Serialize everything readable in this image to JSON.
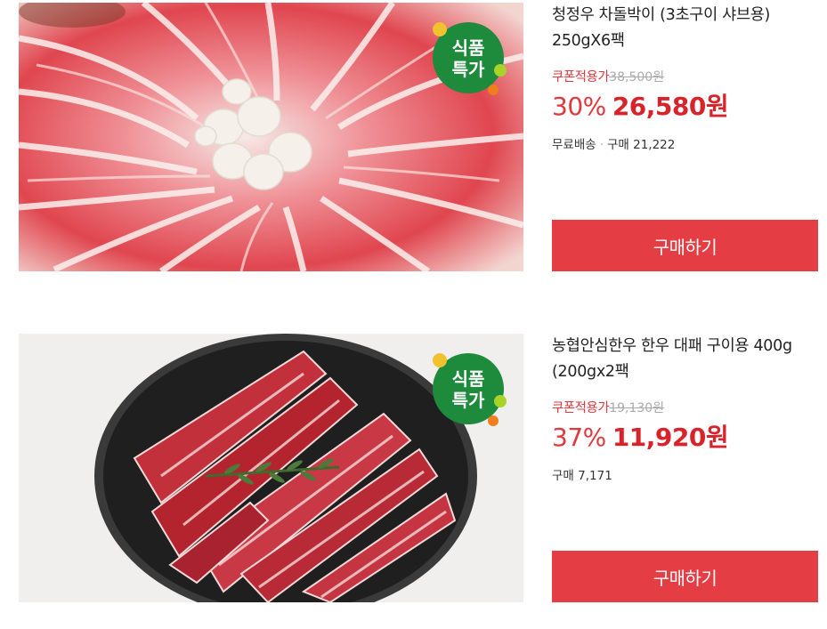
{
  "badge": {
    "line1": "식품",
    "line2": "특가"
  },
  "products": [
    {
      "title_line1": "청정우 차돌박이 (3초구이 샤브용)",
      "title_line2": "250gX6팩",
      "coupon_label": "쿠폰적용가",
      "original_price": "38,500원",
      "discount": "30%",
      "price": "26,580원",
      "shipping": "무료배송",
      "purchases": "구매 21,222",
      "buy_label": "구매하기"
    },
    {
      "title_line1": "농협안심한우 한우 대패 구이용 400g",
      "title_line2": "(200gx2팩",
      "coupon_label": "쿠폰적용가",
      "original_price": "19,130원",
      "discount": "37%",
      "price": "11,920원",
      "purchases": "구매 7,171",
      "buy_label": "구매하기"
    }
  ],
  "colors": {
    "accent": "#e43d43",
    "badge_green": "#1e8a3c",
    "badge_yellow": "#f2c12e",
    "badge_lime": "#a8d42a",
    "badge_orange": "#f07d1e"
  }
}
